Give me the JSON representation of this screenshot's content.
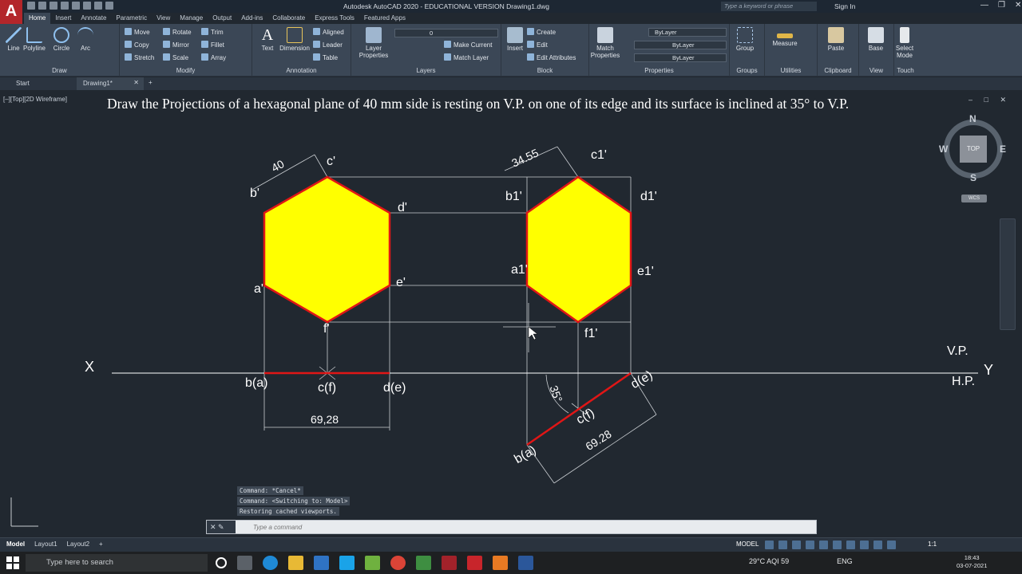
{
  "app": {
    "logo": "A",
    "window_title": "Autodesk AutoCAD 2020 - EDUCATIONAL VERSION   Drawing1.dwg",
    "search_placeholder": "Type a keyword or phrase",
    "sign_in": "Sign In",
    "window_controls": [
      "—",
      "❐",
      "✕"
    ]
  },
  "menu_tabs": [
    "Home",
    "Insert",
    "Annotate",
    "Parametric",
    "View",
    "Manage",
    "Output",
    "Add-ins",
    "Collaborate",
    "Express Tools",
    "Featured Apps"
  ],
  "ribbon": {
    "draw": {
      "label": "Draw",
      "buttons": [
        "Line",
        "Polyline",
        "Circle",
        "Arc"
      ]
    },
    "modify": {
      "label": "Modify",
      "buttons": [
        "Move",
        "Rotate",
        "Trim",
        "Copy",
        "Mirror",
        "Fillet",
        "Stretch",
        "Scale",
        "Array"
      ]
    },
    "annotation": {
      "label": "Annotation",
      "buttons": [
        "Text",
        "Dimension",
        "Aligned",
        "Leader",
        "Table"
      ]
    },
    "layers": {
      "label": "Layers",
      "buttons": [
        "Layer Properties",
        "Make Current",
        "Match Layer"
      ],
      "current_layer": "0"
    },
    "block": {
      "label": "Block",
      "buttons": [
        "Insert",
        "Create",
        "Edit",
        "Edit Attributes"
      ]
    },
    "properties": {
      "label": "Properties",
      "match": "Match Properties",
      "color": "ByLayer",
      "linetype": "ByLayer",
      "lineweight": "ByLayer"
    },
    "groups": {
      "label": "Groups",
      "button": "Group"
    },
    "utilities": {
      "label": "Utilities",
      "button": "Measure"
    },
    "clipboard": {
      "label": "Clipboard",
      "button": "Paste"
    },
    "view": {
      "label": "View",
      "button": "Base"
    },
    "touch": {
      "label": "Touch",
      "button": "Select Mode"
    }
  },
  "file_tabs": {
    "start": "Start",
    "drawing": "Drawing1*",
    "close": "✕",
    "add": "+"
  },
  "viewport": {
    "label": "[–][Top][2D Wireframe]",
    "controls": "– □ ✕",
    "heading": "Draw the Projections of a hexagonal plane of 40 mm side is resting on V.P. on one of its edge and its surface is inclined at 35° to V.P."
  },
  "drawing": {
    "labels": {
      "b_prime": "b'",
      "c_prime": "c'",
      "d_prime": "d'",
      "a_prime": "a'",
      "e_prime": "e'",
      "f_prime": "f'",
      "c1_prime": "c1'",
      "b1_prime": "b1'",
      "d1_prime": "d1'",
      "a1_prime": "a1'",
      "e1_prime": "e1'",
      "f1_prime": "f1'",
      "x": "X",
      "y": "Y",
      "vp": "V.P.",
      "hp": "H.P.",
      "ba": "b(a)",
      "cf": "c(f)",
      "de": "d(e)",
      "ba2": "b(a)",
      "cf2": "c(f)",
      "de2": "d(e)"
    },
    "dims": {
      "side": "40",
      "side2": "34.55",
      "width": "69,28",
      "width2": "69.28",
      "angle": "35°"
    },
    "fill_color": "#ffff00",
    "edge_color": "#e01616"
  },
  "viewcube": {
    "n": "N",
    "s": "S",
    "e": "E",
    "w": "W",
    "top": "TOP",
    "wcs": "WCS"
  },
  "command": {
    "history": [
      "Command: *Cancel*",
      "Command:   <Switching to: Model>",
      "Restoring cached viewports."
    ],
    "placeholder": "Type a command"
  },
  "status": {
    "layout_tabs": [
      "Model",
      "Layout1",
      "Layout2",
      "+"
    ],
    "model": "MODEL",
    "scale": "1:1"
  },
  "taskbar": {
    "search": "Type here to search",
    "weather": "29°C  AQI 59",
    "lang": "ENG",
    "time": "18:43",
    "date": "03-07-2021"
  }
}
